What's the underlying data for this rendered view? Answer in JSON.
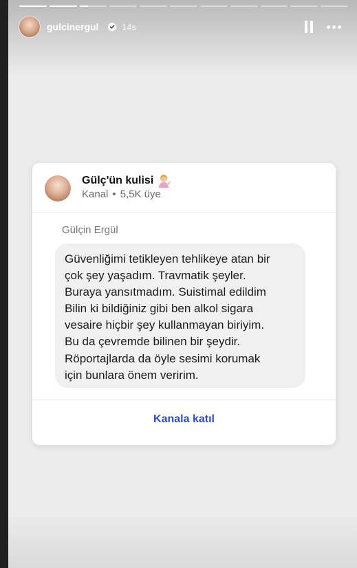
{
  "story": {
    "segments": [
      1,
      1,
      0.3,
      0,
      0,
      0,
      0,
      0,
      0,
      0,
      0
    ],
    "username": "gulcinergul",
    "time": "14s",
    "icons": [
      "verified-badge-icon",
      "pause-icon",
      "more-options-icon"
    ]
  },
  "channel": {
    "name": "Gülç'ün kulisi",
    "emoji": "person-tipping-hand-emoji",
    "type": "Kanal",
    "members": "5,5K üye",
    "sender": "Gülçin Ergül",
    "message_lines": [
      "Güvenliğimi tetikleyen tehlikeye atan bir",
      "çok şey yaşadım. Travmatik şeyler.",
      "Buraya yansıtmadım. Suistimal edildim",
      "Bilin ki bildiğiniz gibi ben alkol sigara",
      "vesaire hiçbir şey kullanmayan biriyim.",
      "Bu da çevremde bilinen bir şeydir.",
      "Röportajlarda da öyle sesimi korumak",
      "için bunlara önem veririm."
    ],
    "join_label": "Kanala katıl",
    "colors": {
      "join": "#2f4bd0",
      "verified": "#3897f0"
    }
  }
}
